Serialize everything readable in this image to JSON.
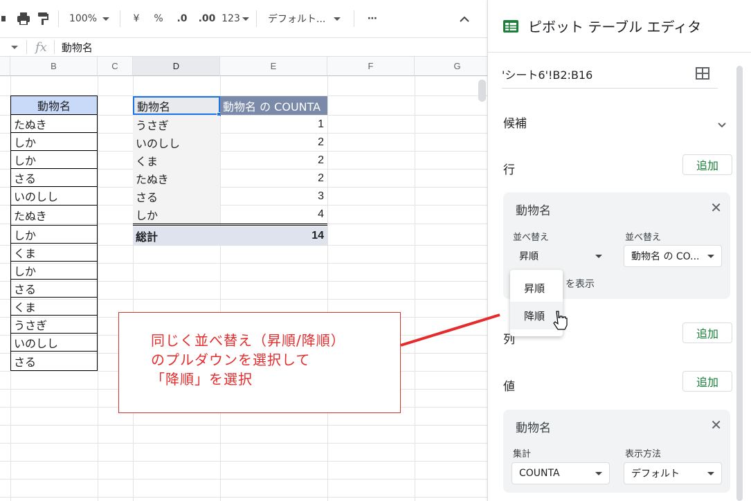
{
  "toolbar": {
    "zoom": "100%",
    "currency": "¥",
    "percent": "%",
    "decrease_decimals": ".0",
    "increase_decimals": ".00",
    "number_format": "123",
    "font": "デフォルト...",
    "more": "⋯",
    "collapse": "^"
  },
  "formula_bar": {
    "fx": "fx",
    "value": "動物名"
  },
  "columns": [
    "B",
    "C",
    "D",
    "E",
    "F",
    "G"
  ],
  "source_table": {
    "header": "動物名",
    "rows": [
      "たぬき",
      "しか",
      "しか",
      "さる",
      "いのしし",
      "たぬき",
      "しか",
      "くま",
      "しか",
      "さる",
      "くま",
      "うさぎ",
      "いのしし",
      "さる"
    ]
  },
  "pivot_table": {
    "header_name": "動物名",
    "header_count": "動物名 の COUNTA",
    "rows": [
      {
        "name": "うさぎ",
        "count": "1"
      },
      {
        "name": "いのしし",
        "count": "2"
      },
      {
        "name": "くま",
        "count": "2"
      },
      {
        "name": "たぬき",
        "count": "2"
      },
      {
        "name": "さる",
        "count": "3"
      },
      {
        "name": "しか",
        "count": "4"
      }
    ],
    "total_label": "総計",
    "total_value": "14"
  },
  "annotation": {
    "line1": "同じく並べ替え（昇順/降順）",
    "line2": "のプルダウンを選択して",
    "line3": "「降順」を選択",
    "color": "#e52b2b"
  },
  "panel": {
    "title": "ピボット テーブル エディタ",
    "range": "'シート6'!B2:B16",
    "suggestions": "候補",
    "rows_label": "行",
    "columns_label": "列",
    "values_label": "値",
    "add": "追加",
    "row_field": {
      "name": "動物名",
      "sort_label": "並べ替え",
      "sort_value": "昇順",
      "sort_by_label": "並べ替え",
      "sort_by_value": "動物名 の CO...",
      "show_totals_partial": "を表示"
    },
    "value_field": {
      "name": "動物名",
      "summarize_label": "集計",
      "summarize_value": "COUNTA",
      "show_as_label": "表示方法",
      "show_as_value": "デフォルト"
    },
    "dropdown": {
      "options": [
        "昇順",
        "降順"
      ]
    },
    "accent": "#188038"
  }
}
